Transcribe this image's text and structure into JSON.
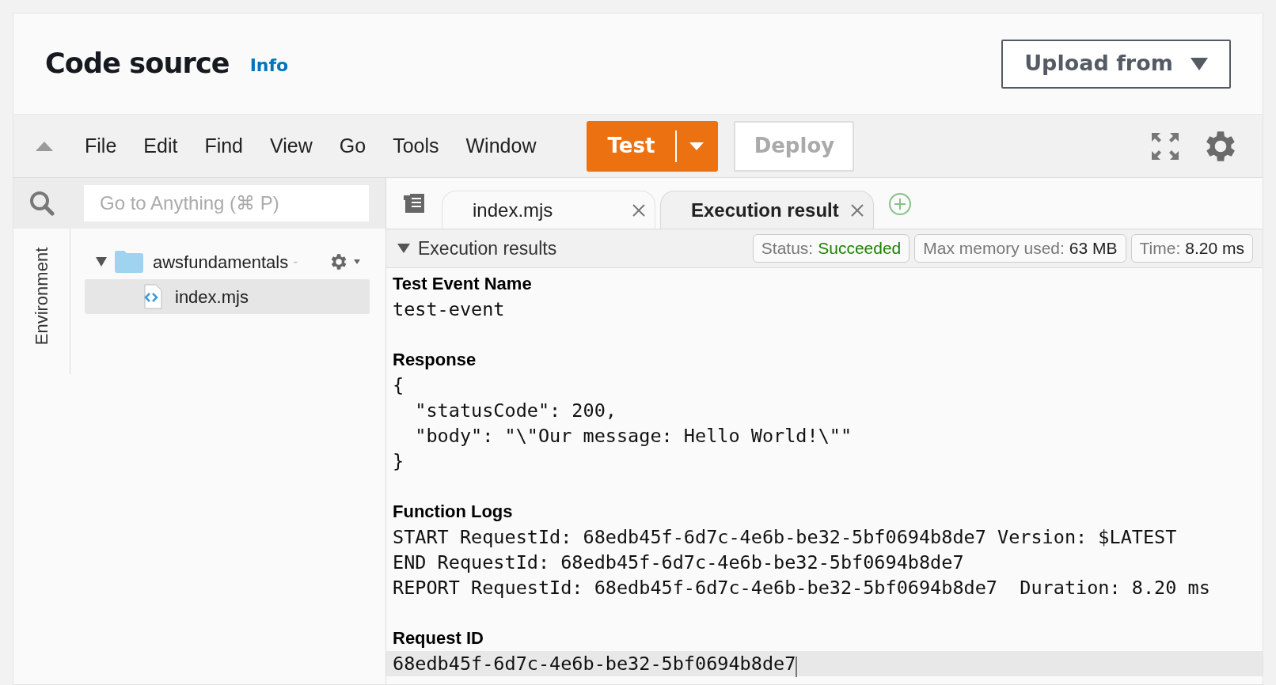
{
  "header": {
    "title": "Code source",
    "info_link": "Info",
    "upload_button": "Upload from"
  },
  "toolbar": {
    "menus": [
      "File",
      "Edit",
      "Find",
      "View",
      "Go",
      "Tools",
      "Window"
    ],
    "test_button": "Test",
    "deploy_button": {
      "label": "Deploy",
      "disabled": true
    }
  },
  "sidebar": {
    "search_placeholder": "Go to Anything (⌘ P)",
    "environment_tab": "Environment",
    "tree": [
      {
        "label": "awsfundamentals",
        "suffix": "-",
        "expanded": true,
        "selected": false,
        "children": [
          {
            "label": "index.mjs",
            "selected": true
          }
        ]
      }
    ]
  },
  "editor_tabs": [
    {
      "label": "index.mjs",
      "selected": false
    },
    {
      "label": "Execution result",
      "selected": true
    }
  ],
  "results_panel": {
    "title": "Execution results",
    "expanded": true,
    "badges": [
      {
        "label": "Status:",
        "value": "Succeeded",
        "kind": "status"
      },
      {
        "label": "Max memory used:",
        "value": "63 MB",
        "kind": "plain"
      },
      {
        "label": "Time:",
        "value": "8.20 ms",
        "kind": "plain"
      }
    ],
    "sections": [
      {
        "heading": "Test Event Name",
        "lines": [
          {
            "text": "test-event",
            "current": false
          }
        ]
      },
      {
        "heading": "Response",
        "lines": [
          {
            "text": "{",
            "current": false
          },
          {
            "text": "  \"statusCode\": 200,",
            "current": false
          },
          {
            "text": "  \"body\": \"\\\"Our message: Hello World!\\\"\"",
            "current": false
          },
          {
            "text": "}",
            "current": false
          }
        ]
      },
      {
        "heading": "Function Logs",
        "lines": [
          {
            "text": "START RequestId: 68edb45f-6d7c-4e6b-be32-5bf0694b8de7 Version: $LATEST",
            "current": false
          },
          {
            "text": "END RequestId: 68edb45f-6d7c-4e6b-be32-5bf0694b8de7",
            "current": false
          },
          {
            "text": "REPORT RequestId: 68edb45f-6d7c-4e6b-be32-5bf0694b8de7  Duration: 8.20 ms",
            "current": false
          }
        ]
      },
      {
        "heading": "Request ID",
        "lines": [
          {
            "text": "68edb45f-6d7c-4e6b-be32-5bf0694b8de7",
            "current": true
          }
        ]
      }
    ]
  }
}
